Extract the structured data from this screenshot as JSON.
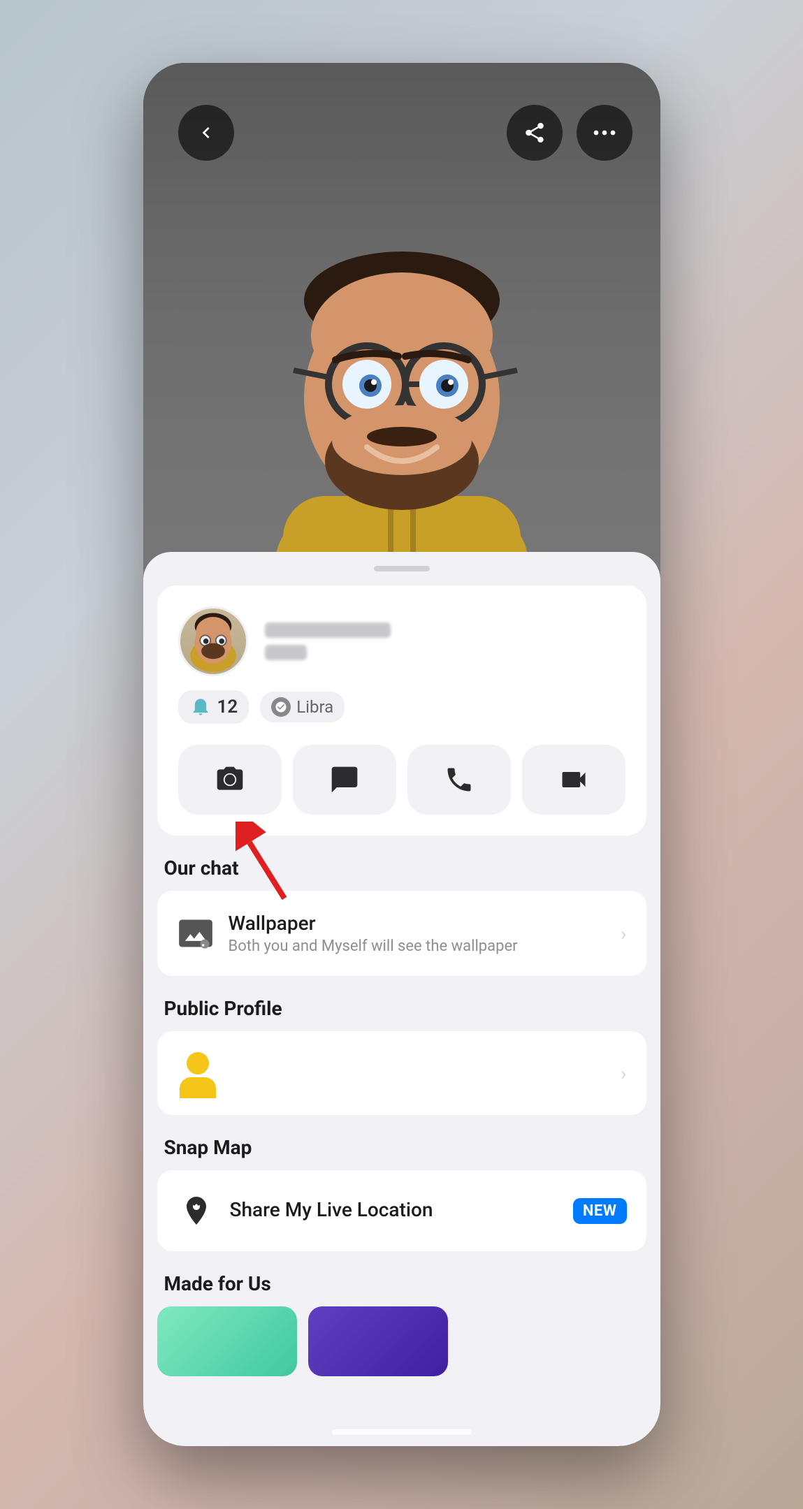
{
  "header": {
    "back_label": "‹",
    "share_label": "share",
    "more_label": "···"
  },
  "profile": {
    "snap_score": "12",
    "zodiac": "Libra",
    "zodiac_icon": "⚖"
  },
  "actions": {
    "camera": "camera",
    "chat": "chat",
    "phone": "phone",
    "video": "video"
  },
  "sections": {
    "our_chat": {
      "label": "Our chat",
      "wallpaper": {
        "title": "Wallpaper",
        "subtitle": "Both you and Myself will see the wallpaper"
      }
    },
    "public_profile": {
      "label": "Public Profile"
    },
    "snap_map": {
      "label": "Snap Map",
      "share_location": {
        "title": "Share My Live Location",
        "badge": "NEW"
      }
    },
    "made_for_us": {
      "label": "Made for Us"
    }
  },
  "colors": {
    "accent_blue": "#007aff",
    "snap_teal": "#5bb8c4",
    "yellow": "#f5c518"
  }
}
